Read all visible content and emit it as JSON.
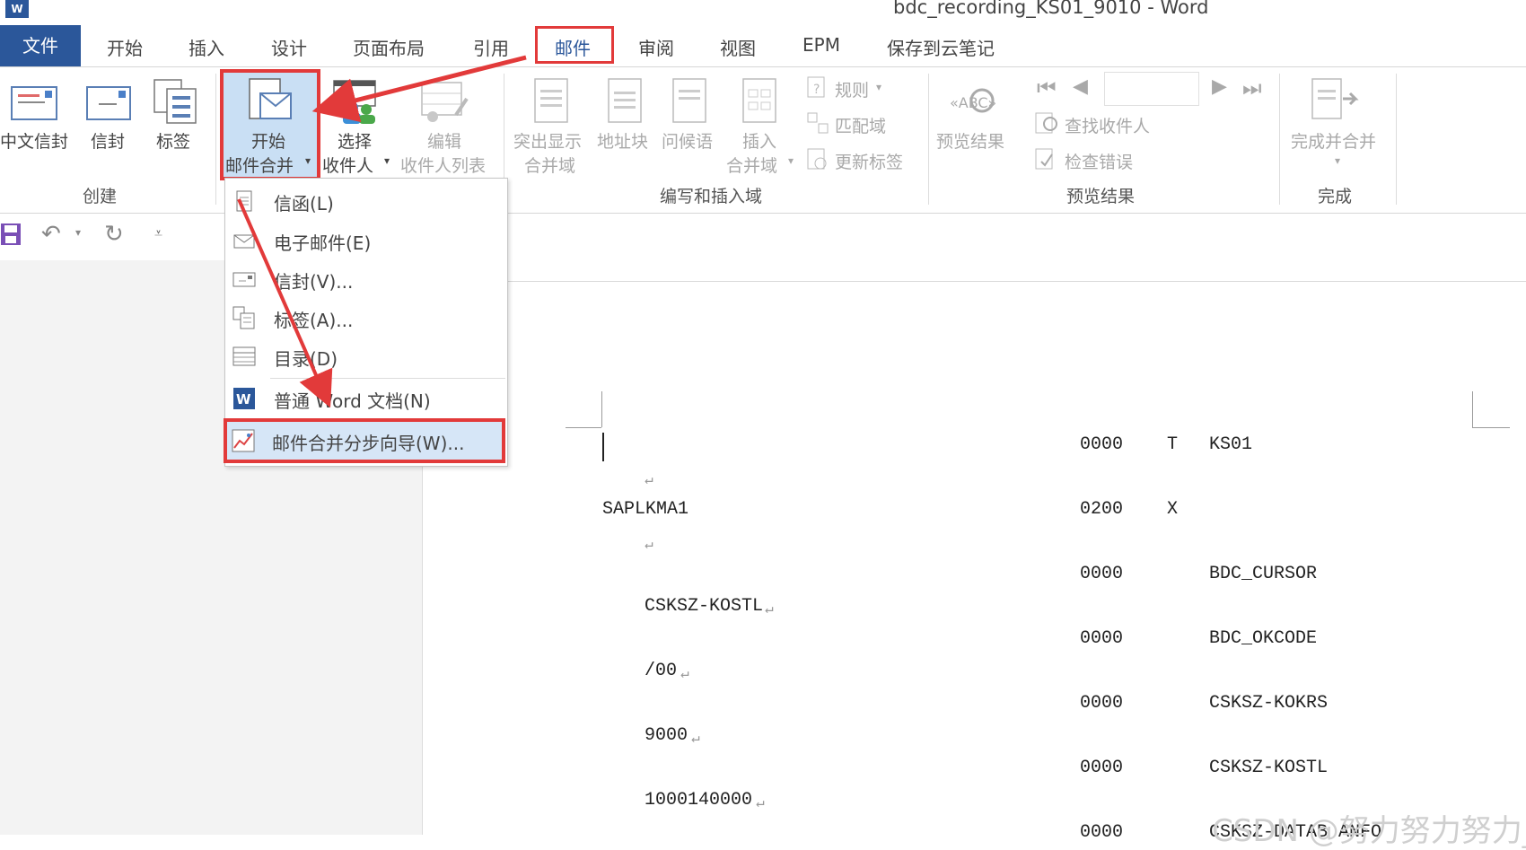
{
  "window": {
    "title": "bdc_recording_KS01_9010 - Word",
    "app_icon_text": "W"
  },
  "tabs": {
    "file": "文件",
    "items": [
      "开始",
      "插入",
      "设计",
      "页面布局",
      "引用",
      "邮件",
      "审阅",
      "视图",
      "EPM",
      "保存到云笔记"
    ],
    "active": "邮件"
  },
  "ribbon": {
    "create": {
      "group_label": "创建",
      "cn_envelope": "中文信封",
      "envelope": "信封",
      "labels": "标签"
    },
    "start_merge": {
      "start_line1": "开始",
      "start_line2": "邮件合并",
      "select_line1": "选择",
      "select_line2": "收件人",
      "edit_line1": "编辑",
      "edit_line2": "收件人列表"
    },
    "write_insert": {
      "group_label": "编写和插入域",
      "highlight_line1": "突出显示",
      "highlight_line2": "合并域",
      "address_block": "地址块",
      "greeting": "问候语",
      "insert_line1": "插入",
      "insert_line2": "合并域",
      "rules": "规则",
      "match_fields": "匹配域",
      "update_labels": "更新标签"
    },
    "preview": {
      "group_label": "预览结果",
      "preview_results": "预览结果",
      "find_recipient": "查找收件人",
      "check_errors": "检查错误",
      "record_value": ""
    },
    "finish": {
      "group_label": "完成",
      "finish_merge": "完成并合并"
    }
  },
  "dropdown": {
    "items": [
      {
        "label": "信函(L)",
        "icon": "letter-icon"
      },
      {
        "label": "电子邮件(E)",
        "icon": "email-icon"
      },
      {
        "label": "信封(V)...",
        "icon": "envelope-icon"
      },
      {
        "label": "标签(A)...",
        "icon": "labels-icon"
      },
      {
        "label": "目录(D)",
        "icon": "directory-icon"
      },
      {
        "label": "普通 Word 文档(N)",
        "icon": "word-doc-icon"
      },
      {
        "label": "邮件合并分步向导(W)...",
        "icon": "wizard-icon"
      }
    ]
  },
  "document": {
    "left_lines": [
      "SAPLKMA1",
      "CSKSZ-KOSTL",
      "/00",
      "9000",
      "1000140000"
    ],
    "mid_codes": [
      "0000",
      "0200",
      "0000",
      "0000",
      "0000",
      "0000",
      "0000"
    ],
    "flags": [
      "T",
      "X"
    ],
    "right_fields": [
      "KS01",
      "BDC_CURSOR",
      "BDC_OKCODE",
      "CSKSZ-KOKRS",
      "CSKSZ-KOSTL",
      "CSKSZ-DATAB_ANFO"
    ],
    "paragraph_mark": "↵"
  },
  "watermark": "CSDN @努力努力努力_",
  "colors": {
    "accent": "#2b579a",
    "highlight_border": "#e23a3a",
    "arrow": "#e23a3a"
  }
}
